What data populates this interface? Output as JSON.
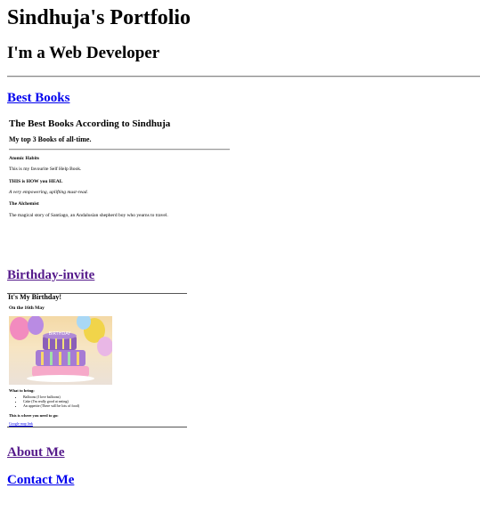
{
  "header": {
    "title": "Sindhuja's Portfolio",
    "subtitle": "I'm a Web Developer"
  },
  "links": {
    "best_books": "Best Books",
    "birthday_invite": "Birthday-invite",
    "about_me": "About Me",
    "contact_me": "Contact Me"
  },
  "books": {
    "title": "The Best Books According to Sindhuja",
    "subtitle": "My top 3 Books of all-time.",
    "items": [
      {
        "title": "Atomic Habits",
        "desc": "This is my favourite Self Help Book."
      },
      {
        "title": "THIS is HOW you HEAL",
        "desc": "A very empowering, uplifting must-read."
      },
      {
        "title": "The Alchemist",
        "desc": "The magical story of Santiago, an Andalusian shepherd boy who yearns to travel."
      }
    ]
  },
  "birthday": {
    "title": "It's My Birthday!",
    "date": "On the 16th May",
    "cake_image": "birthday-cake",
    "bring_label": "What to bring:",
    "bring_items": [
      "Balloons (I love balloons)",
      "Cake (I'm really good at eating)",
      "An appetite (There will be lots of food)"
    ],
    "where_label": "This is where you need to go:",
    "map_link": "Google map link"
  },
  "colors": {
    "link_unvisited": "#0000ee",
    "link_visited": "#551a8b"
  }
}
